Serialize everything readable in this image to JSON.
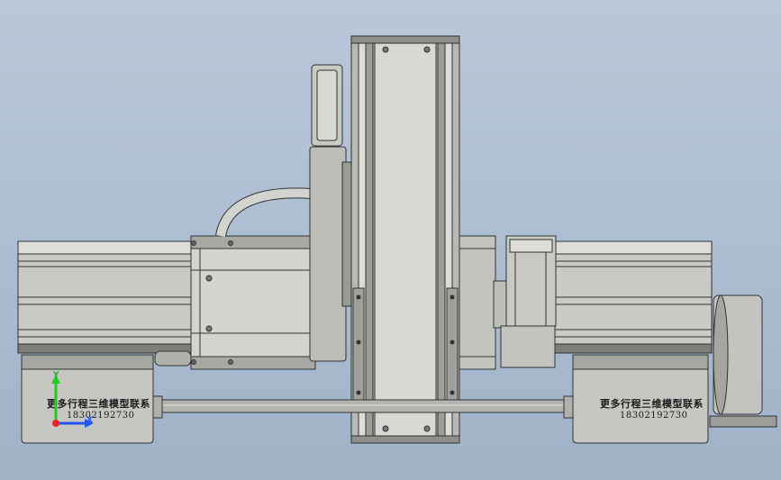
{
  "viewport": {
    "background_top": "#b9c8d9",
    "background_bottom": "#9fb2c8"
  },
  "model": {
    "left_mount_label": "更多行程三维模型联系",
    "left_mount_phone": "18302192730",
    "right_mount_label": "更多行程三维模型联系",
    "right_mount_phone": "18302192730"
  },
  "triad": {
    "y_axis": "Y",
    "x_axis": "X",
    "y_color": "#22cc22",
    "x_color": "#2255ee",
    "z_color": "#ee2222"
  },
  "colors": {
    "part": "#c9c9c6",
    "part_light": "#dededb",
    "part_dark": "#8d8d8a",
    "edge": "#333333"
  }
}
